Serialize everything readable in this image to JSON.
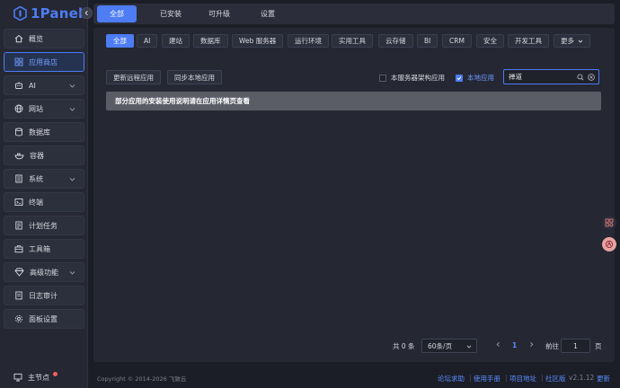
{
  "sidebar": {
    "logo_text": "1Panel",
    "items": [
      {
        "label": "概览",
        "icon": "home-icon"
      },
      {
        "label": "应用商店",
        "icon": "grid-icon",
        "active": true
      },
      {
        "label": "AI",
        "icon": "robot-icon",
        "chevron": true
      },
      {
        "label": "网站",
        "icon": "globe-icon",
        "chevron": true
      },
      {
        "label": "数据库",
        "icon": "database-icon"
      },
      {
        "label": "容器",
        "icon": "container-icon"
      },
      {
        "label": "系统",
        "icon": "system-icon",
        "chevron": true
      },
      {
        "label": "终端",
        "icon": "terminal-icon"
      },
      {
        "label": "计划任务",
        "icon": "cron-icon"
      },
      {
        "label": "工具箱",
        "icon": "toolbox-icon"
      },
      {
        "label": "高级功能",
        "icon": "diamond-icon",
        "chevron": true
      },
      {
        "label": "日志审计",
        "icon": "log-icon"
      },
      {
        "label": "面板设置",
        "icon": "gear-icon"
      }
    ],
    "node_label": "主节点"
  },
  "top_tabs": [
    "全部",
    "已安装",
    "可升级",
    "设置"
  ],
  "filters": [
    "全部",
    "AI",
    "建站",
    "数据库",
    "Web 服务器",
    "运行环境",
    "实用工具",
    "云存储",
    "BI",
    "CRM",
    "安全",
    "开发工具",
    "更多"
  ],
  "actions": {
    "sync_remote": "更新远程应用",
    "sync_local": "同步本地应用"
  },
  "checkboxes": {
    "server_arch": "本服务器架构应用",
    "local_apps": "本地应用"
  },
  "search": {
    "value": "禅道"
  },
  "notice": "部分应用的安装使用说明请在应用详情页查看",
  "pagination": {
    "total": "共 0 条",
    "page_size": "60条/页",
    "current_page": "1",
    "goto_label": "前往",
    "goto_value": "1",
    "page_unit": "页"
  },
  "footer": {
    "copyright": "Copyright © 2014-2026 飞致云",
    "links": [
      "论坛求助",
      "使用手册",
      "项目地址",
      "社区版"
    ],
    "version": "v2.1.12",
    "update": "更新"
  },
  "colors": {
    "accent": "#4d7cf3",
    "background": "#1c1e27",
    "panel": "#252733"
  }
}
